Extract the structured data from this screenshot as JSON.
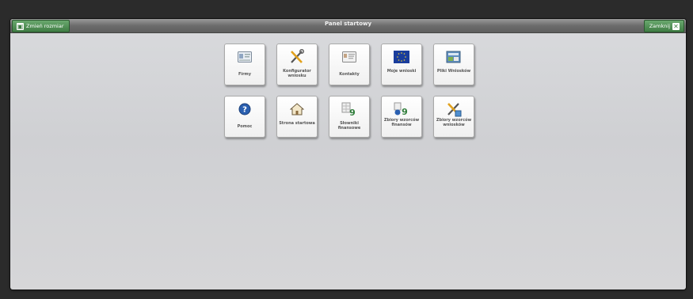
{
  "window": {
    "title": "Panel startowy",
    "restore_label": "Zmień rozmiar",
    "close_label": "Zamknij"
  },
  "tiles_row1": [
    {
      "label": "Firmy",
      "icon": "id-card-icon"
    },
    {
      "label": "Konfigurator wniosku",
      "icon": "tools-icon"
    },
    {
      "label": "Kontakty",
      "icon": "contact-card-icon"
    },
    {
      "label": "Moje wnioski",
      "icon": "eu-flag-icon"
    },
    {
      "label": "Pliki Wniosków",
      "icon": "files-icon"
    }
  ],
  "tiles_row2": [
    {
      "label": "Pomoc",
      "icon": "help-icon"
    },
    {
      "label": "Strona startowa",
      "icon": "home-icon"
    },
    {
      "label": "Słowniki finansowe",
      "icon": "dictionary-icon"
    },
    {
      "label": "Zbiory wzorców finansów",
      "icon": "finance-templates-icon"
    },
    {
      "label": "Zbiory wzorców wniosków",
      "icon": "application-templates-icon"
    }
  ],
  "colors": {
    "accent_green": "#3f7d44",
    "eu_blue": "#1a3d9c",
    "help_blue": "#2a5fb0"
  }
}
